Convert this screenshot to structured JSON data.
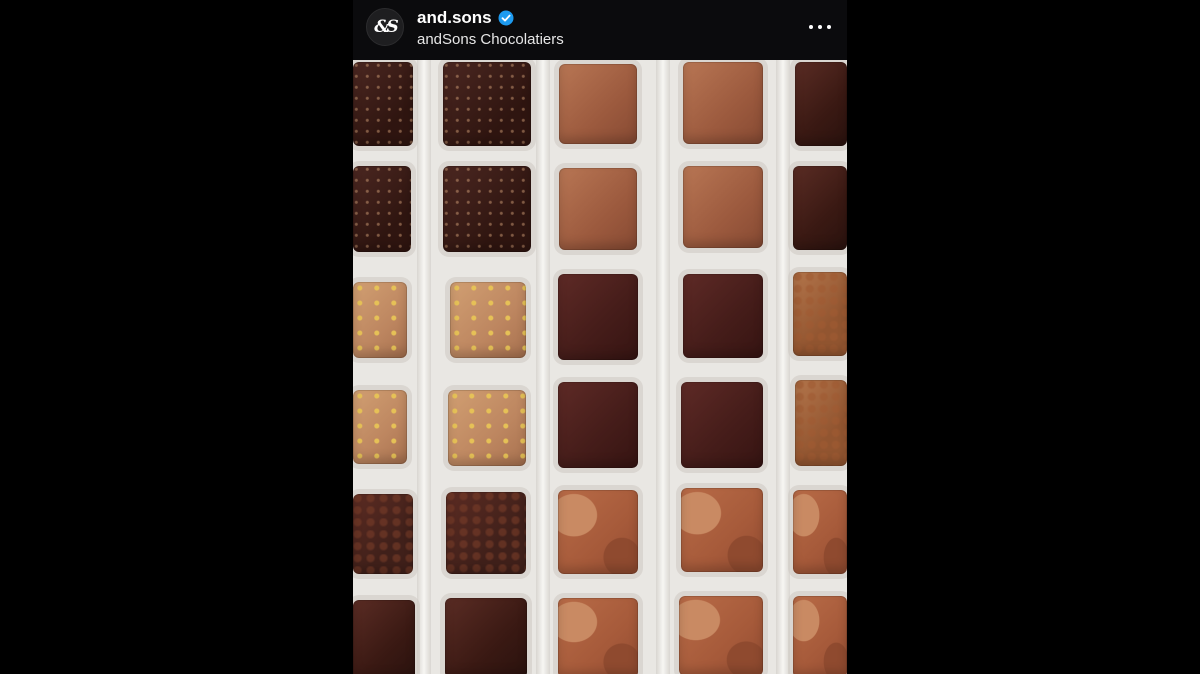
{
  "post": {
    "username": "and.sons",
    "subtitle": "andSons Chocolatiers",
    "avatar_text": "&S",
    "verified_icon": "verified-badge-icon",
    "more_icon": "more-options-icon",
    "accent_color": "#1d9bf0"
  },
  "photo": {
    "icon": "post-image"
  }
}
